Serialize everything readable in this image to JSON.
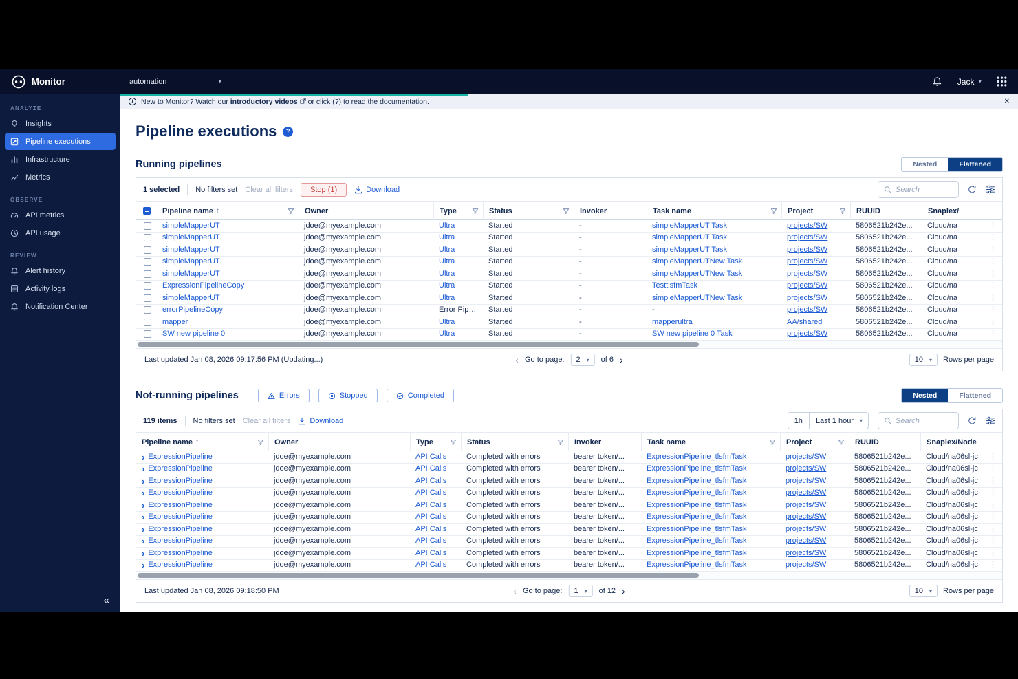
{
  "colors": {
    "accent_blue": "#1d5cd3",
    "navy_text": "#0e2a5c",
    "active_nav_blue": "#2e6be0",
    "toggle_active_navy": "#0d3f85",
    "stop_red": "#c43f3b",
    "teal_accent": "#15b3a4"
  },
  "topbar": {
    "app_name": "Monitor",
    "org_selector": "automation",
    "user_name": "Jack"
  },
  "sidebar": {
    "sections": [
      {
        "label": "ANALYZE",
        "items": [
          {
            "label": "Insights",
            "icon": "insights-icon",
            "active": false
          },
          {
            "label": "Pipeline executions",
            "icon": "pipeline-executions-icon",
            "active": true
          },
          {
            "label": "Infrastructure",
            "icon": "infrastructure-icon",
            "active": false
          },
          {
            "label": "Metrics",
            "icon": "metrics-icon",
            "active": false
          }
        ]
      },
      {
        "label": "OBSERVE",
        "items": [
          {
            "label": "API metrics",
            "icon": "api-metrics-icon",
            "active": false
          },
          {
            "label": "API usage",
            "icon": "api-usage-icon",
            "active": false
          }
        ]
      },
      {
        "label": "REVIEW",
        "items": [
          {
            "label": "Alert history",
            "icon": "alert-history-icon",
            "active": false
          },
          {
            "label": "Activity logs",
            "icon": "activity-logs-icon",
            "active": false
          },
          {
            "label": "Notification Center",
            "icon": "notification-center-icon",
            "active": false
          }
        ]
      }
    ]
  },
  "banner": {
    "prefix": "New to Monitor? Watch our ",
    "link": "introductory videos",
    "suffix": " or click (?) to read the documentation."
  },
  "page": {
    "title": "Pipeline executions"
  },
  "running": {
    "title": "Running pipelines",
    "toggle": {
      "nested": "Nested",
      "flattened": "Flattened",
      "active": "Flattened"
    },
    "toolbar": {
      "selected": "1 selected",
      "no_filters": "No filters set",
      "clear": "Clear all filters",
      "stop": "Stop (1)",
      "download": "Download",
      "search_placeholder": "Search"
    },
    "columns": [
      "Pipeline name",
      "Owner",
      "Type",
      "Status",
      "Invoker",
      "Task name",
      "Project",
      "RUUID",
      "Snaplex/"
    ],
    "rows": [
      {
        "name": "simpleMapperUT",
        "owner": "jdoe@myexample.com",
        "type": "Ultra",
        "status": "Started",
        "invoker": "-",
        "task": "simpleMapperUT Task",
        "project": "projects/SW",
        "ruuid": "5806521b242e...",
        "snaplex": "Cloud/na"
      },
      {
        "name": "simpleMapperUT",
        "owner": "jdoe@myexample.com",
        "type": "Ultra",
        "status": "Started",
        "invoker": "-",
        "task": "simpleMapperUT Task",
        "project": "projects/SW",
        "ruuid": "5806521b242e...",
        "snaplex": "Cloud/na"
      },
      {
        "name": "simpleMapperUT",
        "owner": "jdoe@myexample.com",
        "type": "Ultra",
        "status": "Started",
        "invoker": "-",
        "task": "simpleMapperUT Task",
        "project": "projects/SW",
        "ruuid": "5806521b242e...",
        "snaplex": "Cloud/na"
      },
      {
        "name": "simpleMapperUT",
        "owner": "jdoe@myexample.com",
        "type": "Ultra",
        "status": "Started",
        "invoker": "-",
        "task": "simpleMapperUTNew Task",
        "project": "projects/SW",
        "ruuid": "5806521b242e...",
        "snaplex": "Cloud/na"
      },
      {
        "name": "simpleMapperUT",
        "owner": "jdoe@myexample.com",
        "type": "Ultra",
        "status": "Started",
        "invoker": "-",
        "task": "simpleMapperUTNew Task",
        "project": "projects/SW",
        "ruuid": "5806521b242e...",
        "snaplex": "Cloud/na"
      },
      {
        "name": "ExpressionPipelineCopy",
        "owner": "jdoe@myexample.com",
        "type": "Ultra",
        "status": "Started",
        "invoker": "-",
        "task": "TesttlsfmTask",
        "project": "projects/SW",
        "ruuid": "5806521b242e...",
        "snaplex": "Cloud/na"
      },
      {
        "name": "simpleMapperUT",
        "owner": "jdoe@myexample.com",
        "type": "Ultra",
        "status": "Started",
        "invoker": "-",
        "task": "simpleMapperUTNew Task",
        "project": "projects/SW",
        "ruuid": "5806521b242e...",
        "snaplex": "Cloud/na"
      },
      {
        "name": "errorPipelineCopy",
        "owner": "jdoe@myexample.com",
        "type": "Error Pipe...",
        "status": "Started",
        "invoker": "-",
        "task": "-",
        "project": "projects/SW",
        "ruuid": "5806521b242e...",
        "snaplex": "Cloud/na"
      },
      {
        "name": "mapper",
        "owner": "jdoe@myexample.com",
        "type": "Ultra",
        "status": "Started",
        "invoker": "-",
        "task": "mapperultra",
        "project": "AA/shared",
        "ruuid": "5806521b242e...",
        "snaplex": "Cloud/na"
      },
      {
        "name": "SW new pipeline 0",
        "owner": "jdoe@myexample.com",
        "type": "Ultra",
        "status": "Started",
        "invoker": "-",
        "task": "SW new pipeline 0 Task",
        "project": "projects/SW",
        "ruuid": "5806521b242e...",
        "snaplex": "Cloud/na"
      }
    ],
    "footer": {
      "last_updated": "Last updated Jan 08, 2026 09:17:56 PM (Updating...)",
      "go_to_page": "Go to page:",
      "page": "2",
      "of": "of 6",
      "rows": "10",
      "rows_per_page_label": "Rows per page"
    }
  },
  "notrunning": {
    "title": "Not-running pipelines",
    "filters": [
      {
        "label": "Errors",
        "icon": "errors-icon"
      },
      {
        "label": "Stopped",
        "icon": "stopped-icon"
      },
      {
        "label": "Completed",
        "icon": "completed-icon"
      }
    ],
    "toggle": {
      "nested": "Nested",
      "flattened": "Flattened",
      "active": "Nested"
    },
    "toolbar": {
      "items": "119 items",
      "no_filters": "No filters set",
      "clear": "Clear all filters",
      "download": "Download",
      "time_badge": "1h",
      "time_label": "Last 1 hour",
      "search_placeholder": "Search"
    },
    "columns": [
      "Pipeline name",
      "Owner",
      "Type",
      "Status",
      "Invoker",
      "Task name",
      "Project",
      "RUUID",
      "Snaplex/Node"
    ],
    "rows": [
      {
        "name": "ExpressionPipeline",
        "owner": "jdoe@myexample.com",
        "type": "API Calls",
        "status": "Completed with errors",
        "invoker": "bearer token/...",
        "task": "ExpressionPipeline_tlsfmTask",
        "project": "projects/SW",
        "ruuid": "5806521b242e...",
        "snaplex": "Cloud/na06sl-jc"
      },
      {
        "name": "ExpressionPipeline",
        "owner": "jdoe@myexample.com",
        "type": "API Calls",
        "status": "Completed with errors",
        "invoker": "bearer token/...",
        "task": "ExpressionPipeline_tlsfmTask",
        "project": "projects/SW",
        "ruuid": "5806521b242e...",
        "snaplex": "Cloud/na06sl-jc"
      },
      {
        "name": "ExpressionPipeline",
        "owner": "jdoe@myexample.com",
        "type": "API Calls",
        "status": "Completed with errors",
        "invoker": "bearer token/...",
        "task": "ExpressionPipeline_tlsfmTask",
        "project": "projects/SW",
        "ruuid": "5806521b242e...",
        "snaplex": "Cloud/na06sl-jc"
      },
      {
        "name": "ExpressionPipeline",
        "owner": "jdoe@myexample.com",
        "type": "API Calls",
        "status": "Completed with errors",
        "invoker": "bearer token/...",
        "task": "ExpressionPipeline_tlsfmTask",
        "project": "projects/SW",
        "ruuid": "5806521b242e...",
        "snaplex": "Cloud/na06sl-jc"
      },
      {
        "name": "ExpressionPipeline",
        "owner": "jdoe@myexample.com",
        "type": "API Calls",
        "status": "Completed with errors",
        "invoker": "bearer token/...",
        "task": "ExpressionPipeline_tlsfmTask",
        "project": "projects/SW",
        "ruuid": "5806521b242e...",
        "snaplex": "Cloud/na06sl-jc"
      },
      {
        "name": "ExpressionPipeline",
        "owner": "jdoe@myexample.com",
        "type": "API Calls",
        "status": "Completed with errors",
        "invoker": "bearer token/...",
        "task": "ExpressionPipeline_tlsfmTask",
        "project": "projects/SW",
        "ruuid": "5806521b242e...",
        "snaplex": "Cloud/na06sl-jc"
      },
      {
        "name": "ExpressionPipeline",
        "owner": "jdoe@myexample.com",
        "type": "API Calls",
        "status": "Completed with errors",
        "invoker": "bearer token/...",
        "task": "ExpressionPipeline_tlsfmTask",
        "project": "projects/SW",
        "ruuid": "5806521b242e...",
        "snaplex": "Cloud/na06sl-jc"
      },
      {
        "name": "ExpressionPipeline",
        "owner": "jdoe@myexample.com",
        "type": "API Calls",
        "status": "Completed with errors",
        "invoker": "bearer token/...",
        "task": "ExpressionPipeline_tlsfmTask",
        "project": "projects/SW",
        "ruuid": "5806521b242e...",
        "snaplex": "Cloud/na06sl-jc"
      },
      {
        "name": "ExpressionPipeline",
        "owner": "jdoe@myexample.com",
        "type": "API Calls",
        "status": "Completed with errors",
        "invoker": "bearer token/...",
        "task": "ExpressionPipeline_tlsfmTask",
        "project": "projects/SW",
        "ruuid": "5806521b242e...",
        "snaplex": "Cloud/na06sl-jc"
      },
      {
        "name": "ExpressionPipeline",
        "owner": "jdoe@myexample.com",
        "type": "API Calls",
        "status": "Completed with errors",
        "invoker": "bearer token/...",
        "task": "ExpressionPipeline_tlsfmTask",
        "project": "projects/SW",
        "ruuid": "5806521b242e...",
        "snaplex": "Cloud/na06sl-jc"
      }
    ],
    "footer": {
      "last_updated": "Last updated Jan 08, 2026 09:18:50 PM",
      "go_to_page": "Go to page:",
      "page": "1",
      "of": "of 12",
      "rows": "10",
      "rows_per_page_label": "Rows per page"
    }
  }
}
